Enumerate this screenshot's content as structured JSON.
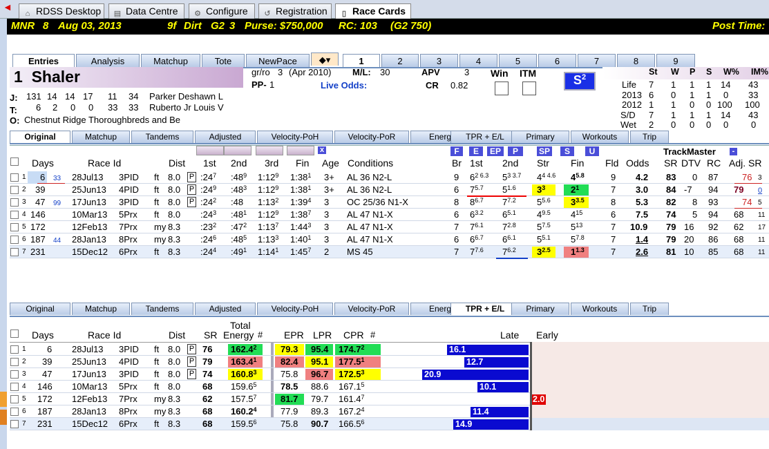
{
  "app_tabs": [
    {
      "label": "RDSS Desktop",
      "icon": "home-icon"
    },
    {
      "label": "Data Centre",
      "icon": "database-icon"
    },
    {
      "label": "Configure",
      "icon": "gear-icon"
    },
    {
      "label": "Registration",
      "icon": "registration-icon"
    },
    {
      "label": "Race Cards",
      "icon": "document-icon"
    }
  ],
  "race": {
    "track": "MNR",
    "race_no": "8",
    "date": "Aug 03, 2013",
    "distance": "9f",
    "surface": "Dirt",
    "grade": "G2",
    "field": "3",
    "purse": "Purse: $750,000",
    "rc": "RC: 103",
    "rc_grade": "(G2 750)",
    "post_time": "Post Time:"
  },
  "view_tabs": [
    "Entries",
    "Analysis",
    "Matchup",
    "Tote",
    "NewPace"
  ],
  "horse_tabs": [
    "1",
    "2",
    "3",
    "4",
    "5",
    "6",
    "7",
    "8",
    "9"
  ],
  "horse": {
    "number": "1",
    "name": "Shaler",
    "breed": "gr/ro",
    "age": "3",
    "foaled": "(Apr 2010)",
    "ml_label": "M/L:",
    "ml": "30",
    "pp_label": "PP-",
    "pp": "1",
    "live_odds": "Live Odds:",
    "apv_label": "APV",
    "apv": "3",
    "cr_label": "CR",
    "cr": "0.82",
    "win": "Win",
    "itm": "ITM",
    "speed_badge": "S",
    "speed_badge_sup": "2"
  },
  "connections": {
    "jockey_label": "J:",
    "jockey_stats": [
      "131",
      "14",
      "14",
      "17",
      "11",
      "34"
    ],
    "jockey": "Parker Deshawn L",
    "trainer_label": "T:",
    "trainer_stats": [
      "6",
      "2",
      "0",
      "0",
      "33",
      "33"
    ],
    "trainer": "Ruberto Jr Louis V",
    "owner_label": "O:",
    "owner": "Chestnut Ridge Thoroughbreds and Be"
  },
  "record": {
    "headers": [
      "St",
      "W",
      "P",
      "S",
      "W%",
      "IM%"
    ],
    "rows": [
      {
        "label": "Life",
        "vals": [
          "7",
          "1",
          "1",
          "1",
          "14",
          "43"
        ]
      },
      {
        "label": "2013",
        "vals": [
          "6",
          "0",
          "1",
          "1",
          "0",
          "33"
        ]
      },
      {
        "label": "2012",
        "vals": [
          "1",
          "1",
          "0",
          "0",
          "100",
          "100"
        ]
      },
      {
        "label": "S/D",
        "vals": [
          "7",
          "1",
          "1",
          "1",
          "14",
          "43"
        ]
      },
      {
        "label": "Wet",
        "vals": [
          "2",
          "0",
          "0",
          "0",
          "0",
          "0"
        ]
      }
    ]
  },
  "pp_tabs": [
    "Original",
    "Matchup",
    "Tandems",
    "Adjusted",
    "Velocity-PoH",
    "Velocity-PoR",
    "Energy",
    "TPR + E/L",
    "Primary",
    "Workouts",
    "Trip"
  ],
  "top_table": {
    "headers": {
      "days": "Days",
      "race_id": "Race Id",
      "dist": "Dist",
      "c1": "1st",
      "c2": "2nd",
      "c3": "3rd",
      "fin": "Fin",
      "age": "Age",
      "cond": "Conditions",
      "br": "Br",
      "p1": "1st",
      "p2": "2nd",
      "str": "Str",
      "pfin": "Fin",
      "fld": "Fld",
      "odds": "Odds",
      "sr": "SR",
      "dtv": "DTV",
      "rc": "RC",
      "adjsr": "Adj. SR",
      "trackmaster": "TrackMaster"
    },
    "pace_buttons": [
      "F",
      "E",
      "EP",
      "P",
      "SP",
      "S",
      "U"
    ],
    "x_btn": "x",
    "minus_btn": "-",
    "rows": [
      {
        "n": "1",
        "days": "6",
        "days_sup": "33",
        "date": "28Jul13",
        "race": "3PID",
        "surf": "ft",
        "dist": "8.0",
        "p": "P",
        "f1": ":24",
        "f1s": "7",
        "f2": ":48",
        "f2s": "9",
        "f3": "1:12",
        "f3s": "9",
        "fin": "1:38",
        "fins": "1",
        "age": "3+",
        "cond": "AL 36 N2-L",
        "br": "9",
        "p1": "6",
        "p1s": "2 6.3",
        "p2": "5",
        "p2s": "3 3.7",
        "st": "4",
        "sts": "4 4.6",
        "pf": "4",
        "pfs": "5.8",
        "fld": "9",
        "odds": "4.2",
        "sr": "83",
        "dtv": "0",
        "rc": "87",
        "adj": "76",
        "adjs": "3"
      },
      {
        "n": "2",
        "days": "39",
        "days_sup": "",
        "date": "25Jun13",
        "race": "4PID",
        "surf": "ft",
        "dist": "8.0",
        "p": "P",
        "f1": ":24",
        "f1s": "9",
        "f2": ":48",
        "f2s": "3",
        "f3": "1:12",
        "f3s": "9",
        "fin": "1:38",
        "fins": "1",
        "age": "3+",
        "cond": "AL 36 N2-L",
        "br": "6",
        "p1": "7",
        "p1s": "5.7",
        "p2": "5",
        "p2s": "1.6",
        "st": "3",
        "sts": "3",
        "pf": "2",
        "pfs": "1",
        "fld": "7",
        "odds": "3.0",
        "sr": "84",
        "dtv": "-7",
        "rc": "94",
        "adj": "79",
        "adjs": "0"
      },
      {
        "n": "3",
        "days": "47",
        "days_sup": "99",
        "date": "17Jun13",
        "race": "3PID",
        "surf": "ft",
        "dist": "8.0",
        "p": "P",
        "f1": ":24",
        "f1s": "2",
        "f2": ":48",
        "f2s": "",
        "f3": "1:13",
        "f3s": "2",
        "fin": "1:39",
        "fins": "4",
        "age": "3",
        "cond": "OC 25/36 N1-X",
        "br": "8",
        "p1": "8",
        "p1s": "6.7",
        "p2": "7",
        "p2s": "7.2",
        "st": "5",
        "sts": "5.6",
        "pf": "3",
        "pfs": "3.5",
        "fld": "8",
        "odds": "5.3",
        "sr": "82",
        "dtv": "8",
        "rc": "93",
        "adj": "74",
        "adjs": "5"
      },
      {
        "n": "4",
        "days": "146",
        "days_sup": "",
        "date": "10Mar13",
        "race": "5Prx",
        "surf": "ft",
        "dist": "8.0",
        "p": "",
        "f1": ":24",
        "f1s": "3",
        "f2": ":48",
        "f2s": "1",
        "f3": "1:12",
        "f3s": "9",
        "fin": "1:38",
        "fins": "7",
        "age": "3",
        "cond": "AL 47 N1-X",
        "br": "6",
        "p1": "6",
        "p1s": "3.2",
        "p2": "6",
        "p2s": "5.1",
        "st": "4",
        "sts": "9.5",
        "pf": "4",
        "pfs": "15",
        "fld": "6",
        "odds": "7.5",
        "sr": "74",
        "dtv": "5",
        "rc": "94",
        "adj": "68",
        "adjs": "11"
      },
      {
        "n": "5",
        "days": "172",
        "days_sup": "",
        "date": "12Feb13",
        "race": "7Prx",
        "surf": "my",
        "dist": "8.3",
        "p": "",
        "f1": ":23",
        "f1s": "2",
        "f2": ":47",
        "f2s": "2",
        "f3": "1:13",
        "f3s": "7",
        "fin": "1:44",
        "fins": "3",
        "age": "3",
        "cond": "AL 47 N1-X",
        "br": "7",
        "p1": "7",
        "p1s": "6.1",
        "p2": "7",
        "p2s": "2.8",
        "st": "5",
        "sts": "7.5",
        "pf": "5",
        "pfs": "13",
        "fld": "7",
        "odds": "10.9",
        "sr": "79",
        "dtv": "16",
        "rc": "92",
        "adj": "62",
        "adjs": "17"
      },
      {
        "n": "6",
        "days": "187",
        "days_sup": "44",
        "date": "28Jan13",
        "race": "8Prx",
        "surf": "my",
        "dist": "8.3",
        "p": "",
        "f1": ":24",
        "f1s": "6",
        "f2": ":48",
        "f2s": "5",
        "f3": "1:13",
        "f3s": "3",
        "fin": "1:40",
        "fins": "1",
        "age": "3",
        "cond": "AL 47 N1-X",
        "br": "6",
        "p1": "6",
        "p1s": "6.7",
        "p2": "6",
        "p2s": "6.1",
        "st": "5",
        "sts": "5.1",
        "pf": "5",
        "pfs": "7.8",
        "fld": "7",
        "odds": "1.4",
        "sr": "79",
        "dtv": "20",
        "rc": "86",
        "adj": "68",
        "adjs": "11"
      },
      {
        "n": "7",
        "days": "231",
        "days_sup": "",
        "date": "15Dec12",
        "race": "6Prx",
        "surf": "ft",
        "dist": "8.3",
        "p": "",
        "f1": ":24",
        "f1s": "4",
        "f2": ":49",
        "f2s": "1",
        "f3": "1:14",
        "f3s": "1",
        "fin": "1:45",
        "fins": "7",
        "age": "2",
        "cond": "MS 45",
        "br": "7",
        "p1": "7",
        "p1s": "7.6",
        "p2": "7",
        "p2s": "6.2",
        "st": "3",
        "sts": "2.5",
        "pf": "1",
        "pfs": "1.3",
        "fld": "7",
        "odds": "2.6",
        "sr": "81",
        "dtv": "10",
        "rc": "85",
        "adj": "68",
        "adjs": "11"
      }
    ]
  },
  "bottom_table": {
    "headers": {
      "days": "Days",
      "race_id": "Race Id",
      "dist": "Dist",
      "sr": "SR",
      "energy": "Total",
      "energy2": "Energy",
      "hash": "#",
      "epr": "EPR",
      "lpr": "LPR",
      "cpr": "CPR",
      "late": "Late",
      "early": "Early"
    },
    "rows": [
      {
        "n": "1",
        "days": "6",
        "date": "28Jul13",
        "race": "3PID",
        "surf": "ft",
        "dist": "8.0",
        "p": "P",
        "sr": "76",
        "te": "162.4",
        "ter": "2",
        "epr": "79.3",
        "lpr": "95.4",
        "cpr": "174.7",
        "cprr": "2",
        "late": "16.1",
        "early": ""
      },
      {
        "n": "2",
        "days": "39",
        "date": "25Jun13",
        "race": "4PID",
        "surf": "ft",
        "dist": "8.0",
        "p": "P",
        "sr": "79",
        "te": "163.4",
        "ter": "1",
        "epr": "82.4",
        "lpr": "95.1",
        "cpr": "177.5",
        "cprr": "1",
        "late": "12.7",
        "early": ""
      },
      {
        "n": "3",
        "days": "47",
        "date": "17Jun13",
        "race": "3PID",
        "surf": "ft",
        "dist": "8.0",
        "p": "P",
        "sr": "74",
        "te": "160.8",
        "ter": "3",
        "epr": "75.8",
        "lpr": "96.7",
        "cpr": "172.5",
        "cprr": "3",
        "late": "20.9",
        "early": ""
      },
      {
        "n": "4",
        "days": "146",
        "date": "10Mar13",
        "race": "5Prx",
        "surf": "ft",
        "dist": "8.0",
        "p": "",
        "sr": "68",
        "te": "159.6",
        "ter": "5",
        "epr": "78.5",
        "lpr": "88.6",
        "cpr": "167.1",
        "cprr": "5",
        "late": "10.1",
        "early": ""
      },
      {
        "n": "5",
        "days": "172",
        "date": "12Feb13",
        "race": "7Prx",
        "surf": "my",
        "dist": "8.3",
        "p": "",
        "sr": "62",
        "te": "157.5",
        "ter": "7",
        "epr": "81.7",
        "lpr": "79.7",
        "cpr": "161.4",
        "cprr": "7",
        "late": "",
        "early": "2.0"
      },
      {
        "n": "6",
        "days": "187",
        "date": "28Jan13",
        "race": "8Prx",
        "surf": "my",
        "dist": "8.3",
        "p": "",
        "sr": "68",
        "te": "160.2",
        "ter": "4",
        "epr": "77.9",
        "lpr": "89.3",
        "cpr": "167.2",
        "cprr": "4",
        "late": "11.4",
        "early": ""
      },
      {
        "n": "7",
        "days": "231",
        "date": "15Dec12",
        "race": "6Prx",
        "surf": "ft",
        "dist": "8.3",
        "p": "",
        "sr": "68",
        "te": "159.5",
        "ter": "6",
        "epr": "75.8",
        "lpr": "90.7",
        "cpr": "166.5",
        "cprr": "6",
        "late": "14.9",
        "early": ""
      }
    ]
  },
  "colors": {
    "accent": "#1340c8",
    "green": "#22dd55",
    "yellow": "#ffff00",
    "red": "#f08080",
    "bar": "#0a0ad0",
    "early_bar": "#e00000"
  }
}
